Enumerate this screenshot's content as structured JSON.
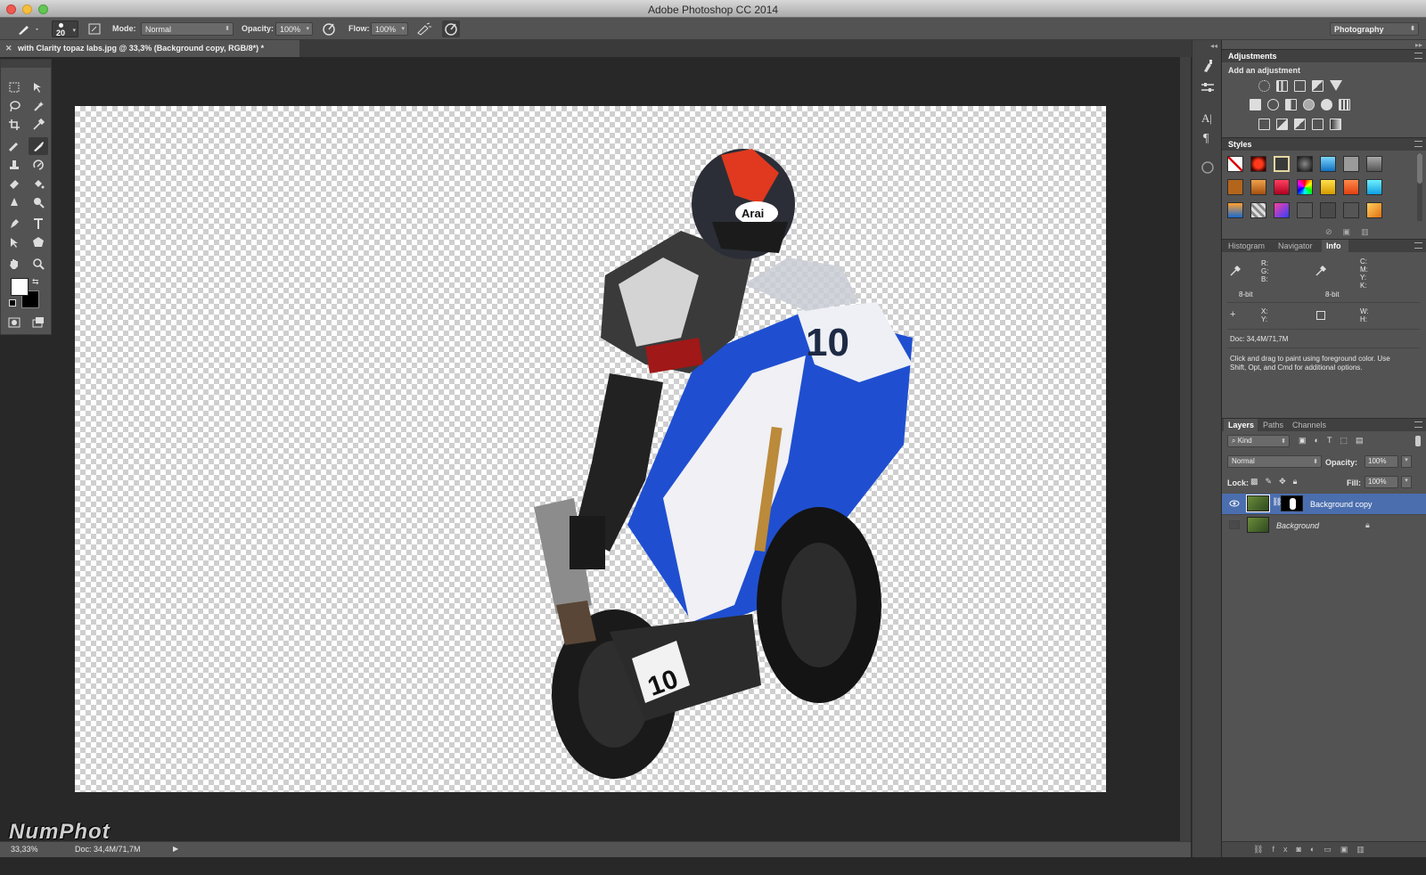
{
  "window": {
    "title": "Adobe Photoshop CC 2014"
  },
  "options_bar": {
    "brush_size": "20",
    "mode_label": "Mode:",
    "mode_value": "Normal",
    "opacity_label": "Opacity:",
    "opacity_value": "100%",
    "flow_label": "Flow:",
    "flow_value": "100%",
    "workspace": "Photography"
  },
  "document": {
    "tab_title": "with Clarity topaz labs.jpg @ 33,3% (Background copy, RGB/8*) *"
  },
  "status": {
    "zoom": "33,33%",
    "doc_size": "Doc: 34,4M/71,7M"
  },
  "adjustments": {
    "tab": "Adjustments",
    "subtitle": "Add an adjustment"
  },
  "styles": {
    "tab": "Styles"
  },
  "info_panel": {
    "tabs": [
      "Histogram",
      "Navigator",
      "Info"
    ],
    "rgb_labels": "R:\nG:\nB:",
    "cmyk_labels": "C:\nM:\nY:\nK:",
    "bit_left": "8-bit",
    "bit_right": "8-bit",
    "xy_labels": "X:\nY:",
    "wh_labels": "W:\nH:",
    "doc_size": "Doc: 34,4M/71,7M",
    "hint": "Click and drag to paint using foreground color.  Use Shift, Opt, and Cmd for additional options."
  },
  "layers_panel": {
    "tabs": [
      "Layers",
      "Paths",
      "Channels"
    ],
    "filter_kind": "Kind",
    "blend_mode": "Normal",
    "opacity_label": "Opacity:",
    "opacity_value": "100%",
    "lock_label": "Lock:",
    "fill_label": "Fill:",
    "fill_value": "100%",
    "layers": [
      {
        "name": "Background copy",
        "visible": true,
        "selected": true
      },
      {
        "name": "Background",
        "visible": false,
        "selected": false,
        "locked": true
      }
    ]
  },
  "watermark": "NumPhot",
  "colors": {
    "panel_bg": "#535353",
    "canvas_bg": "#282828",
    "selection": "#4b6eaf",
    "foreground": "#ffffff",
    "background": "#000000"
  },
  "icons": [
    "brush-icon",
    "marquee-icon",
    "move-icon",
    "lasso-icon",
    "magic-wand-icon",
    "crop-icon",
    "eyedropper-icon",
    "healing-brush-icon",
    "brush-tool-icon",
    "stamp-icon",
    "history-brush-icon",
    "eraser-icon",
    "paint-bucket-icon",
    "blur-icon",
    "dodge-icon",
    "pen-icon",
    "type-icon",
    "path-select-icon",
    "shape-icon",
    "hand-icon",
    "zoom-icon",
    "quick-mask-icon",
    "screen-mode-icon",
    "eye-icon",
    "lock-icon",
    "link-icon"
  ]
}
